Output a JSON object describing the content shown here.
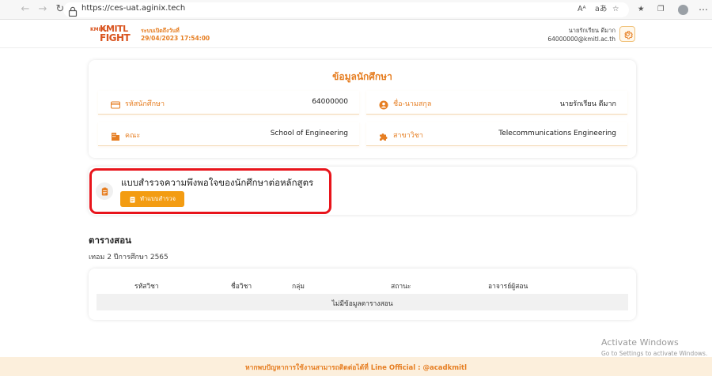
{
  "browser": {
    "url": "https://ces-uat.aginix.tech",
    "reader_icon": "Aᴬ",
    "translate_icon": "aあ"
  },
  "header": {
    "logo_top": "KMITL",
    "logo_bottom": "FIGHT",
    "logo_small": "KMITL",
    "system_label": "ระบบเปิดถึงวันที่",
    "system_time": "29/04/2023 17:54:00",
    "user_name": "นายรักเรียน ดีมาก",
    "user_email": "64000000@kmitl.ac.th"
  },
  "info": {
    "title": "ข้อมูลนักศึกษา",
    "student_id_label": "รหัสนักศึกษา",
    "student_id_value": "64000000",
    "name_label": "ชื่อ-นามสกุล",
    "name_value": "นายรักเรียน ดีมาก",
    "faculty_label": "คณะ",
    "faculty_value": "School of Engineering",
    "major_label": "สาขาวิชา",
    "major_value": "Telecommunications Engineering"
  },
  "survey": {
    "title": "แบบสำรวจความพึงพอใจของนักศึกษาต่อหลักสูตร",
    "button_label": "ทำแบบสำรวจ"
  },
  "timetable": {
    "title": "ตารางสอน",
    "term": "เทอม 2 ปีการศึกษา 2565",
    "columns": [
      "รหัสวิชา",
      "ชื่อวิชา",
      "กลุ่ม",
      "สถานะ",
      "อาจารย์ผู้สอน"
    ],
    "empty_message": "ไม่มีข้อมูลตารางสอน"
  },
  "footer": {
    "text": "หากพบปัญหาการใช้งานสามารถติดต่อได้ที่ Line Official : @acadkmitl"
  },
  "watermark": {
    "line1": "Activate Windows",
    "line2": "Go to Settings to activate Windows."
  },
  "colors": {
    "accent": "#e67e22",
    "button": "#f39c12",
    "highlight": "#e8141b"
  }
}
